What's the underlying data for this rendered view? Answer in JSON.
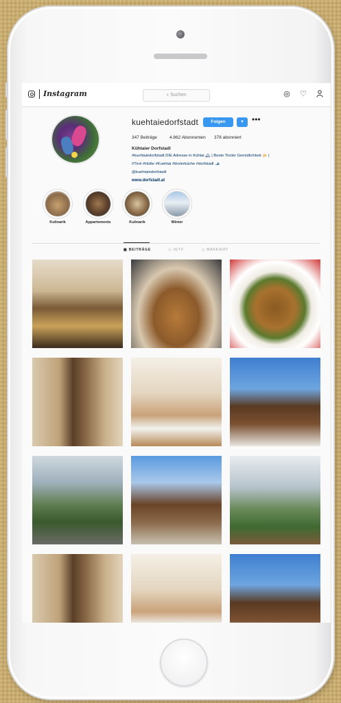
{
  "colors": {
    "accent": "#3897f0",
    "link": "#003569",
    "text": "#262626",
    "border": "#dbdbdb",
    "background": "#c9ad70"
  },
  "topbar": {
    "logo_icon": "instagram-glyph-icon",
    "wordmark": "Instagram",
    "search_placeholder": "Suchen",
    "icons": [
      "compass-icon",
      "heart-icon",
      "user-icon"
    ]
  },
  "profile": {
    "username": "kuehtaiedorfstadt",
    "follow_label": "Folgen",
    "caret": "▾",
    "more": "•••",
    "stats": {
      "posts": "347 Beiträge",
      "followers": "4.862 Abonnenten",
      "following": "378 abonniert"
    },
    "bio_name": "Kühtaier Dorfstadl",
    "bio_lines": [
      "#kuehtaiedorfstadt DIE Adresse in Kühtai 🏔 | Beste Tiroler Gemütlichkeit 🍻 |",
      "#Tirol #Hütte #Kuehtai #tirolerküche #dorfstadl 🎿",
      "@kuehtaiedorfstadt"
    ],
    "url": "www.dorfstadl.at"
  },
  "highlights": [
    {
      "label": "Kulinarik"
    },
    {
      "label": "Appartements"
    },
    {
      "label": "Kulinarik"
    },
    {
      "label": "Winter"
    }
  ],
  "tabs": [
    {
      "label": "▦ BEITRÄGE",
      "active": true
    },
    {
      "label": "▭ IGTV",
      "active": false
    },
    {
      "label": "◻ MARKIERT",
      "active": false
    }
  ],
  "posts": [
    {
      "subject": "terrace-food"
    },
    {
      "subject": "apple-strudel"
    },
    {
      "subject": "soup"
    },
    {
      "subject": "wooden-wall-window"
    },
    {
      "subject": "dining-room"
    },
    {
      "subject": "wooden-chalet"
    },
    {
      "subject": "mountain-terrace"
    },
    {
      "subject": "chalet-exterior"
    },
    {
      "subject": "alpine-valley"
    },
    {
      "subject": "wooden-wall-window"
    },
    {
      "subject": "dining-room"
    },
    {
      "subject": "wooden-chalet"
    }
  ]
}
